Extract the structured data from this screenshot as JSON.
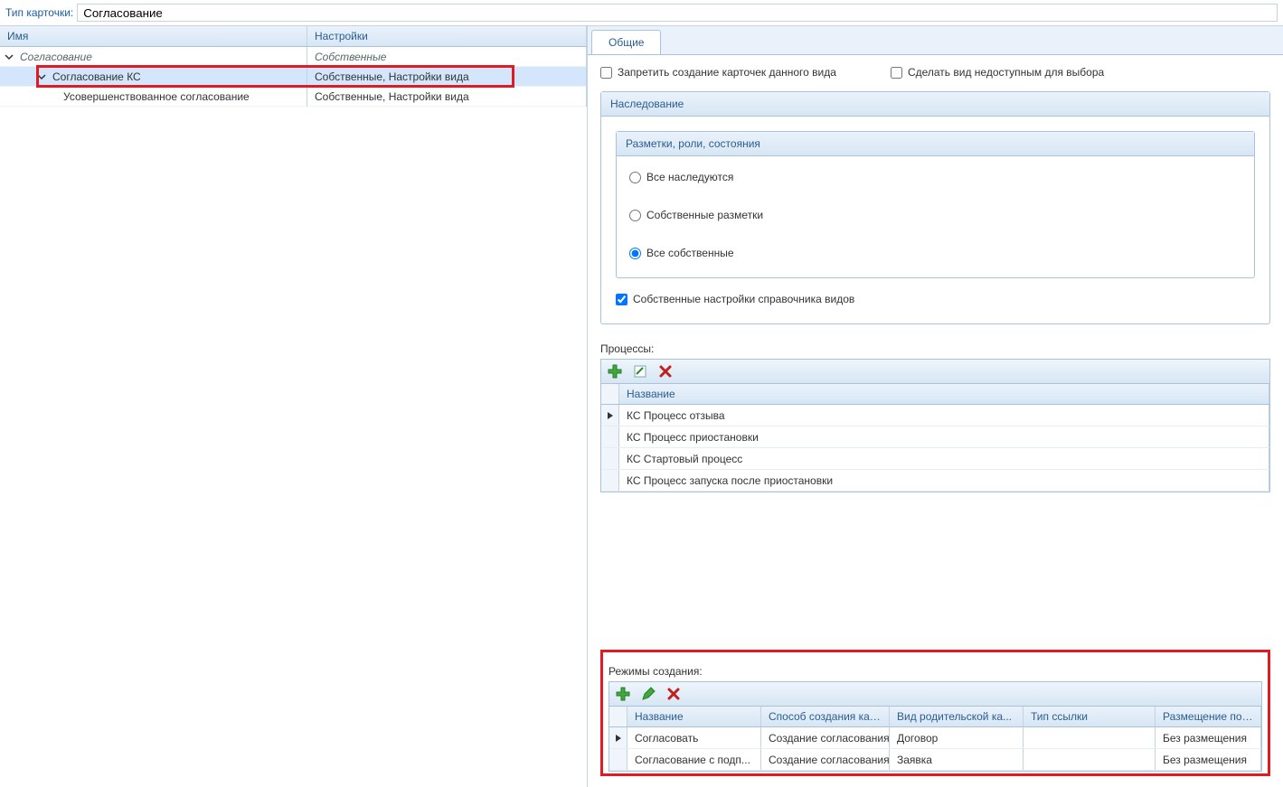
{
  "topbar": {
    "label": "Тип карточки:",
    "value": "Согласование"
  },
  "left": {
    "headers": {
      "name": "Имя",
      "settings": "Настройки"
    },
    "rows": [
      {
        "level": 0,
        "name": "Согласование",
        "settings": "Собственные",
        "expanded": true,
        "italic": true
      },
      {
        "level": 1,
        "name": "Согласование КС",
        "settings": "Собственные, Настройки вида",
        "expanded": true,
        "selected": true,
        "highlight": true
      },
      {
        "level": 2,
        "name": "Усовершенствованное согласование",
        "settings": "Собственные, Настройки вида"
      }
    ]
  },
  "tabs": {
    "general": "Общие"
  },
  "checks": {
    "forbid": "Запретить создание карточек данного вида",
    "unavailable": "Сделать вид недоступным для выбора"
  },
  "inheritance": {
    "title": "Наследование",
    "subgroup_title": "Разметки, роли, состояния",
    "opts": {
      "all_inherit": "Все наследуются",
      "own_layouts": "Собственные разметки",
      "all_own": "Все собственные"
    },
    "own_dir_settings": "Собственные настройки справочника видов"
  },
  "processes": {
    "label": "Процессы:",
    "header": "Название",
    "rows": [
      "КС Процесс отзыва",
      "КС Процесс приостановки",
      "КС Стартовый процесс",
      "КС Процесс запуска после приостановки"
    ]
  },
  "modes": {
    "label": "Режимы создания:",
    "headers": {
      "c1": "Название",
      "c2": "Способ создания кар...",
      "c3": "Вид родительской ка...",
      "c4": "Тип ссылки",
      "c5": "Размещение по умол..."
    },
    "rows": [
      {
        "c1": "Согласовать",
        "c2": "Создание согласования",
        "c3": "Договор",
        "c4": "",
        "c5": "Без размещения",
        "marker": true
      },
      {
        "c1": "Согласование с подп...",
        "c2": "Создание согласования",
        "c3": "Заявка",
        "c4": "",
        "c5": "Без размещения"
      }
    ]
  }
}
